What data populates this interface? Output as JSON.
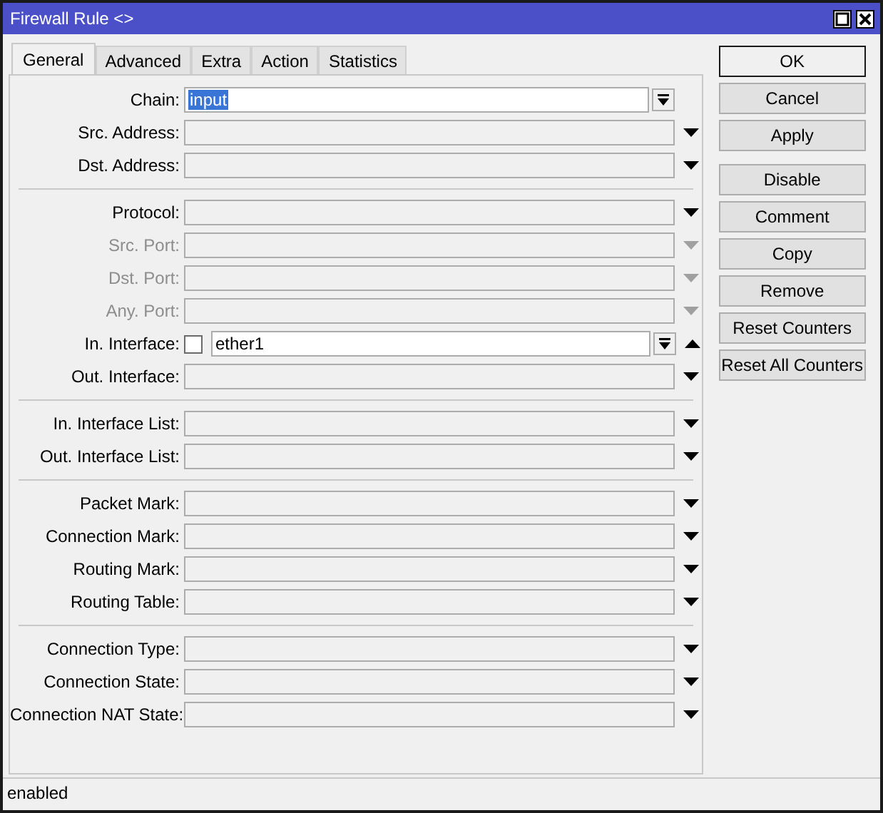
{
  "window": {
    "title": "Firewall Rule <>"
  },
  "tabs": [
    {
      "label": "General",
      "selected": true
    },
    {
      "label": "Advanced",
      "selected": false
    },
    {
      "label": "Extra",
      "selected": false
    },
    {
      "label": "Action",
      "selected": false
    },
    {
      "label": "Statistics",
      "selected": false
    }
  ],
  "groups": [
    {
      "fields": [
        {
          "label": "Chain:",
          "kind": "combo",
          "value": "input",
          "value_selected": true,
          "disabled": false
        },
        {
          "label": "Src. Address:",
          "kind": "dropdown",
          "disabled": false
        },
        {
          "label": "Dst. Address:",
          "kind": "dropdown",
          "disabled": false
        }
      ]
    },
    {
      "fields": [
        {
          "label": "Protocol:",
          "kind": "dropdown",
          "disabled": false
        },
        {
          "label": "Src. Port:",
          "kind": "dropdown",
          "disabled": true
        },
        {
          "label": "Dst. Port:",
          "kind": "dropdown",
          "disabled": true
        },
        {
          "label": "Any. Port:",
          "kind": "dropdown",
          "disabled": true
        },
        {
          "label": "In. Interface:",
          "kind": "interface",
          "checked": false,
          "value": "ether1",
          "disabled": false
        },
        {
          "label": "Out. Interface:",
          "kind": "dropdown",
          "disabled": false
        }
      ]
    },
    {
      "fields": [
        {
          "label": "In. Interface List:",
          "kind": "dropdown",
          "disabled": false
        },
        {
          "label": "Out. Interface List:",
          "kind": "dropdown",
          "disabled": false
        }
      ]
    },
    {
      "fields": [
        {
          "label": "Packet Mark:",
          "kind": "dropdown",
          "disabled": false
        },
        {
          "label": "Connection Mark:",
          "kind": "dropdown",
          "disabled": false
        },
        {
          "label": "Routing Mark:",
          "kind": "dropdown",
          "disabled": false
        },
        {
          "label": "Routing Table:",
          "kind": "dropdown",
          "disabled": false
        }
      ]
    },
    {
      "fields": [
        {
          "label": "Connection Type:",
          "kind": "dropdown",
          "disabled": false
        },
        {
          "label": "Connection State:",
          "kind": "dropdown",
          "disabled": false
        },
        {
          "label": "Connection NAT State:",
          "kind": "dropdown",
          "disabled": false
        }
      ]
    }
  ],
  "button_groups": [
    [
      {
        "label": "OK",
        "default": true
      },
      {
        "label": "Cancel",
        "default": false
      },
      {
        "label": "Apply",
        "default": false
      }
    ],
    [
      {
        "label": "Disable",
        "default": false
      },
      {
        "label": "Comment",
        "default": false
      },
      {
        "label": "Copy",
        "default": false
      },
      {
        "label": "Remove",
        "default": false
      },
      {
        "label": "Reset Counters",
        "default": false
      },
      {
        "label": "Reset All Counters",
        "default": false
      }
    ]
  ],
  "status_bar": "enabled"
}
